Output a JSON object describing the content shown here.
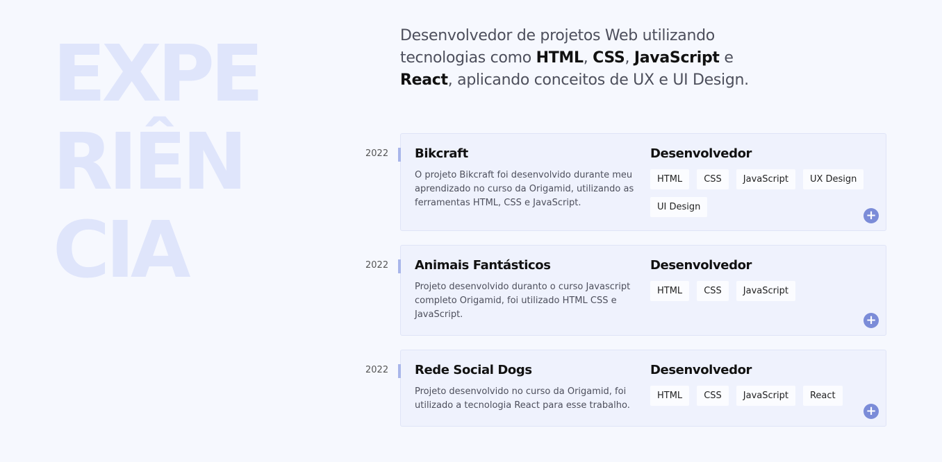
{
  "hero": {
    "big_title_lines": [
      "EXPE",
      "RIÊN",
      "CIA"
    ]
  },
  "intro": {
    "text_1": "Desenvolvedor de projetos Web utilizando tecnologias como ",
    "b1": "HTML",
    "sep1": ", ",
    "b2": "CSS",
    "sep2": ", ",
    "b3": "JavaScript",
    "sep3": " e ",
    "b4": "React",
    "text_2": ", aplicando conceitos de UX e UI Design."
  },
  "experiences": [
    {
      "year": "2022",
      "title": "Bikcraft",
      "description": "O projeto Bikcraft foi desenvolvido durante meu aprendizado no curso da Origamid, utilizando as ferramentas HTML, CSS e JavaScript.",
      "role": "Desenvolvedor",
      "tags": [
        "HTML",
        "CSS",
        "JavaScript",
        "UX Design",
        "UI Design"
      ]
    },
    {
      "year": "2022",
      "title": "Animais Fantásticos",
      "description": "Projeto desenvolvido duranto o curso Javascript completo Origamid, foi utilizado HTML CSS e JavaScript.",
      "role": "Desenvolvedor",
      "tags": [
        "HTML",
        "CSS",
        "JavaScript"
      ]
    },
    {
      "year": "2022",
      "title": "Rede Social Dogs",
      "description": "Projeto desenvolvido no curso da Origamid, foi utilizado a tecnologia React para esse trabalho.",
      "role": "Desenvolvedor",
      "tags": [
        "HTML",
        "CSS",
        "JavaScript",
        "React"
      ]
    }
  ],
  "icons": {
    "expand": "plus-icon",
    "expand_glyph": "+"
  },
  "colors": {
    "background": "#f6f8fe",
    "big_title": "#dfe5fb",
    "card_bg": "#eff2fd",
    "accent": "#7b8cd8",
    "marker": "#a9b6ea"
  }
}
